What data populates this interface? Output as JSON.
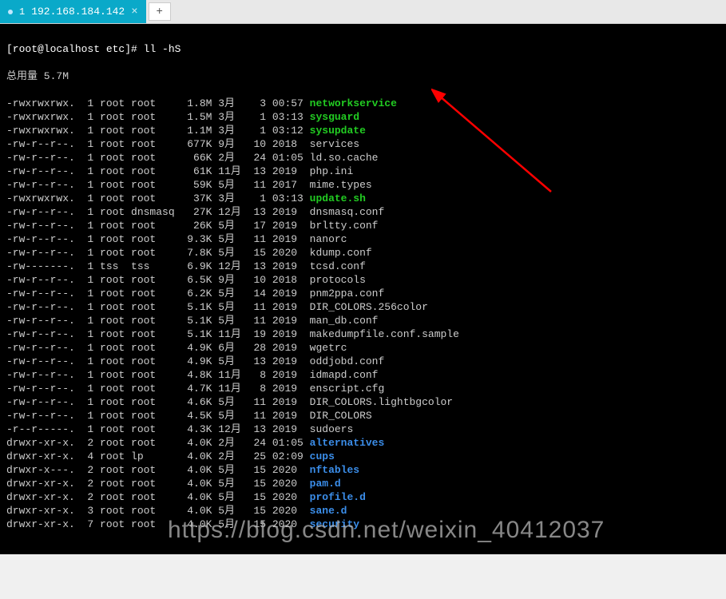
{
  "tabbar": {
    "tab_index": "1",
    "tab_label": "192.168.184.142",
    "close_glyph": "×",
    "newtab_glyph": "+"
  },
  "prompt": {
    "user_host_path": "[root@localhost etc]#",
    "command": "ll -hS"
  },
  "total_line": "总用量 5.7M",
  "watermark": "https://blog.csdn.net/weixin_40412037",
  "rows": [
    {
      "perm": "-rwxrwxrwx.",
      "links": "1",
      "owner": "root",
      "group": "root",
      "size": "1.8M",
      "mon": "3月",
      "day": "3",
      "time": "00:57",
      "name": "networkservice",
      "cls": "c-green-bold"
    },
    {
      "perm": "-rwxrwxrwx.",
      "links": "1",
      "owner": "root",
      "group": "root",
      "size": "1.5M",
      "mon": "3月",
      "day": "1",
      "time": "03:13",
      "name": "sysguard",
      "cls": "c-green-bold"
    },
    {
      "perm": "-rwxrwxrwx.",
      "links": "1",
      "owner": "root",
      "group": "root",
      "size": "1.1M",
      "mon": "3月",
      "day": "1",
      "time": "03:12",
      "name": "sysupdate",
      "cls": "c-green-bold"
    },
    {
      "perm": "-rw-r--r--.",
      "links": "1",
      "owner": "root",
      "group": "root",
      "size": "677K",
      "mon": "9月",
      "day": "10",
      "time": "2018",
      "name": "services",
      "cls": ""
    },
    {
      "perm": "-rw-r--r--.",
      "links": "1",
      "owner": "root",
      "group": "root",
      "size": "66K",
      "mon": "2月",
      "day": "24",
      "time": "01:05",
      "name": "ld.so.cache",
      "cls": ""
    },
    {
      "perm": "-rw-r--r--.",
      "links": "1",
      "owner": "root",
      "group": "root",
      "size": "61K",
      "mon": "11月",
      "day": "13",
      "time": "2019",
      "name": "php.ini",
      "cls": ""
    },
    {
      "perm": "-rw-r--r--.",
      "links": "1",
      "owner": "root",
      "group": "root",
      "size": "59K",
      "mon": "5月",
      "day": "11",
      "time": "2017",
      "name": "mime.types",
      "cls": ""
    },
    {
      "perm": "-rwxrwxrwx.",
      "links": "1",
      "owner": "root",
      "group": "root",
      "size": "37K",
      "mon": "3月",
      "day": "1",
      "time": "03:13",
      "name": "update.sh",
      "cls": "c-green-bold"
    },
    {
      "perm": "-rw-r--r--.",
      "links": "1",
      "owner": "root",
      "group": "dnsmasq",
      "size": "27K",
      "mon": "12月",
      "day": "13",
      "time": "2019",
      "name": "dnsmasq.conf",
      "cls": ""
    },
    {
      "perm": "-rw-r--r--.",
      "links": "1",
      "owner": "root",
      "group": "root",
      "size": "26K",
      "mon": "5月",
      "day": "17",
      "time": "2019",
      "name": "brltty.conf",
      "cls": ""
    },
    {
      "perm": "-rw-r--r--.",
      "links": "1",
      "owner": "root",
      "group": "root",
      "size": "9.3K",
      "mon": "5月",
      "day": "11",
      "time": "2019",
      "name": "nanorc",
      "cls": ""
    },
    {
      "perm": "-rw-r--r--.",
      "links": "1",
      "owner": "root",
      "group": "root",
      "size": "7.8K",
      "mon": "5月",
      "day": "15",
      "time": "2020",
      "name": "kdump.conf",
      "cls": ""
    },
    {
      "perm": "-rw-------.",
      "links": "1",
      "owner": "tss",
      "group": "tss",
      "size": "6.9K",
      "mon": "12月",
      "day": "13",
      "time": "2019",
      "name": "tcsd.conf",
      "cls": ""
    },
    {
      "perm": "-rw-r--r--.",
      "links": "1",
      "owner": "root",
      "group": "root",
      "size": "6.5K",
      "mon": "9月",
      "day": "10",
      "time": "2018",
      "name": "protocols",
      "cls": ""
    },
    {
      "perm": "-rw-r--r--.",
      "links": "1",
      "owner": "root",
      "group": "root",
      "size": "6.2K",
      "mon": "5月",
      "day": "14",
      "time": "2019",
      "name": "pnm2ppa.conf",
      "cls": ""
    },
    {
      "perm": "-rw-r--r--.",
      "links": "1",
      "owner": "root",
      "group": "root",
      "size": "5.1K",
      "mon": "5月",
      "day": "11",
      "time": "2019",
      "name": "DIR_COLORS.256color",
      "cls": ""
    },
    {
      "perm": "-rw-r--r--.",
      "links": "1",
      "owner": "root",
      "group": "root",
      "size": "5.1K",
      "mon": "5月",
      "day": "11",
      "time": "2019",
      "name": "man_db.conf",
      "cls": ""
    },
    {
      "perm": "-rw-r--r--.",
      "links": "1",
      "owner": "root",
      "group": "root",
      "size": "5.1K",
      "mon": "11月",
      "day": "19",
      "time": "2019",
      "name": "makedumpfile.conf.sample",
      "cls": ""
    },
    {
      "perm": "-rw-r--r--.",
      "links": "1",
      "owner": "root",
      "group": "root",
      "size": "4.9K",
      "mon": "6月",
      "day": "28",
      "time": "2019",
      "name": "wgetrc",
      "cls": ""
    },
    {
      "perm": "-rw-r--r--.",
      "links": "1",
      "owner": "root",
      "group": "root",
      "size": "4.9K",
      "mon": "5月",
      "day": "13",
      "time": "2019",
      "name": "oddjobd.conf",
      "cls": ""
    },
    {
      "perm": "-rw-r--r--.",
      "links": "1",
      "owner": "root",
      "group": "root",
      "size": "4.8K",
      "mon": "11月",
      "day": "8",
      "time": "2019",
      "name": "idmapd.conf",
      "cls": ""
    },
    {
      "perm": "-rw-r--r--.",
      "links": "1",
      "owner": "root",
      "group": "root",
      "size": "4.7K",
      "mon": "11月",
      "day": "8",
      "time": "2019",
      "name": "enscript.cfg",
      "cls": ""
    },
    {
      "perm": "-rw-r--r--.",
      "links": "1",
      "owner": "root",
      "group": "root",
      "size": "4.6K",
      "mon": "5月",
      "day": "11",
      "time": "2019",
      "name": "DIR_COLORS.lightbgcolor",
      "cls": ""
    },
    {
      "perm": "-rw-r--r--.",
      "links": "1",
      "owner": "root",
      "group": "root",
      "size": "4.5K",
      "mon": "5月",
      "day": "11",
      "time": "2019",
      "name": "DIR_COLORS",
      "cls": ""
    },
    {
      "perm": "-r--r-----.",
      "links": "1",
      "owner": "root",
      "group": "root",
      "size": "4.3K",
      "mon": "12月",
      "day": "13",
      "time": "2019",
      "name": "sudoers",
      "cls": ""
    },
    {
      "perm": "drwxr-xr-x.",
      "links": "2",
      "owner": "root",
      "group": "root",
      "size": "4.0K",
      "mon": "2月",
      "day": "24",
      "time": "01:05",
      "name": "alternatives",
      "cls": "c-blue"
    },
    {
      "perm": "drwxr-xr-x.",
      "links": "4",
      "owner": "root",
      "group": "lp",
      "size": "4.0K",
      "mon": "2月",
      "day": "25",
      "time": "02:09",
      "name": "cups",
      "cls": "c-blue"
    },
    {
      "perm": "drwxr-x---.",
      "links": "2",
      "owner": "root",
      "group": "root",
      "size": "4.0K",
      "mon": "5月",
      "day": "15",
      "time": "2020",
      "name": "nftables",
      "cls": "c-blue"
    },
    {
      "perm": "drwxr-xr-x.",
      "links": "2",
      "owner": "root",
      "group": "root",
      "size": "4.0K",
      "mon": "5月",
      "day": "15",
      "time": "2020",
      "name": "pam.d",
      "cls": "c-blue"
    },
    {
      "perm": "drwxr-xr-x.",
      "links": "2",
      "owner": "root",
      "group": "root",
      "size": "4.0K",
      "mon": "5月",
      "day": "15",
      "time": "2020",
      "name": "profile.d",
      "cls": "c-blue"
    },
    {
      "perm": "drwxr-xr-x.",
      "links": "3",
      "owner": "root",
      "group": "root",
      "size": "4.0K",
      "mon": "5月",
      "day": "15",
      "time": "2020",
      "name": "sane.d",
      "cls": "c-blue"
    },
    {
      "perm": "drwxr-xr-x.",
      "links": "7",
      "owner": "root",
      "group": "root",
      "size": "4.0K",
      "mon": "5月",
      "day": "15",
      "time": "2020",
      "name": "security",
      "cls": "c-blue"
    }
  ]
}
